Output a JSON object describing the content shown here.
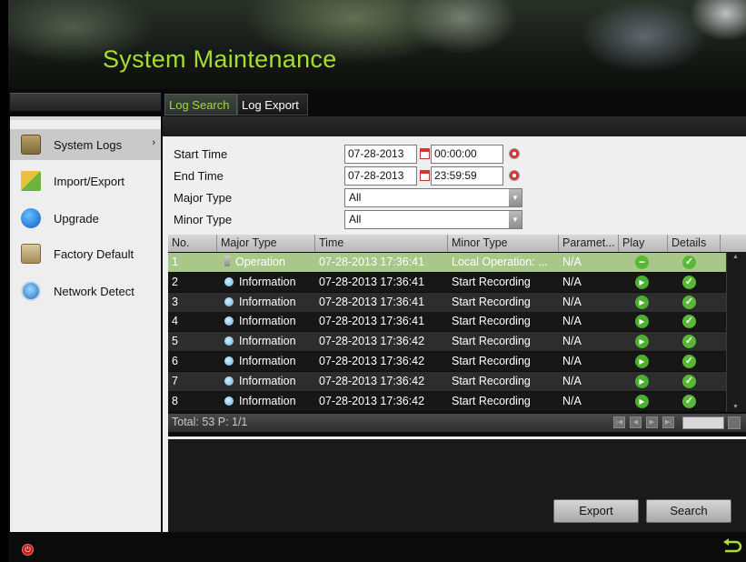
{
  "banner": {
    "title": "System Maintenance"
  },
  "tabs": [
    {
      "label": "Log Search",
      "active": true
    },
    {
      "label": "Log Export",
      "active": false
    }
  ],
  "sidebar": {
    "items": [
      {
        "label": "System Logs",
        "icon": "log-book-icon",
        "active": true,
        "arrow": "›"
      },
      {
        "label": "Import/Export",
        "icon": "import-export-icon"
      },
      {
        "label": "Upgrade",
        "icon": "upgrade-icon"
      },
      {
        "label": "Factory Default",
        "icon": "factory-default-icon"
      },
      {
        "label": "Network Detect",
        "icon": "network-detect-icon"
      }
    ]
  },
  "form": {
    "start_time": {
      "label": "Start Time",
      "date": "07-28-2013",
      "time": "00:00:00"
    },
    "end_time": {
      "label": "End Time",
      "date": "07-28-2013",
      "time": "23:59:59"
    },
    "major_type": {
      "label": "Major Type",
      "value": "All"
    },
    "minor_type": {
      "label": "Minor Type",
      "value": "All"
    }
  },
  "table": {
    "headers": {
      "no": "No.",
      "major": "Major Type",
      "time": "Time",
      "minor": "Minor Type",
      "param": "Paramet...",
      "play": "Play",
      "details": "Details"
    },
    "rows": [
      {
        "no": "1",
        "major": "Operation",
        "time": "07-28-2013 17:36:41",
        "minor": "Local Operation: ...",
        "param": "N/A"
      },
      {
        "no": "2",
        "major": "Information",
        "time": "07-28-2013 17:36:41",
        "minor": "Start Recording",
        "param": "N/A"
      },
      {
        "no": "3",
        "major": "Information",
        "time": "07-28-2013 17:36:41",
        "minor": "Start Recording",
        "param": "N/A"
      },
      {
        "no": "4",
        "major": "Information",
        "time": "07-28-2013 17:36:41",
        "minor": "Start Recording",
        "param": "N/A"
      },
      {
        "no": "5",
        "major": "Information",
        "time": "07-28-2013 17:36:42",
        "minor": "Start Recording",
        "param": "N/A"
      },
      {
        "no": "6",
        "major": "Information",
        "time": "07-28-2013 17:36:42",
        "minor": "Start Recording",
        "param": "N/A"
      },
      {
        "no": "7",
        "major": "Information",
        "time": "07-28-2013 17:36:42",
        "minor": "Start Recording",
        "param": "N/A"
      },
      {
        "no": "8",
        "major": "Information",
        "time": "07-28-2013 17:36:42",
        "minor": "Start Recording",
        "param": "N/A"
      }
    ],
    "selected_row": 0,
    "footer": {
      "total": "Total: 53  P: 1/1"
    }
  },
  "buttons": {
    "export": "Export",
    "search": "Search"
  },
  "colors": {
    "accent_green": "#a7dd2c",
    "selected_row": "#a8c88a",
    "power_red": "#c81e1e"
  }
}
